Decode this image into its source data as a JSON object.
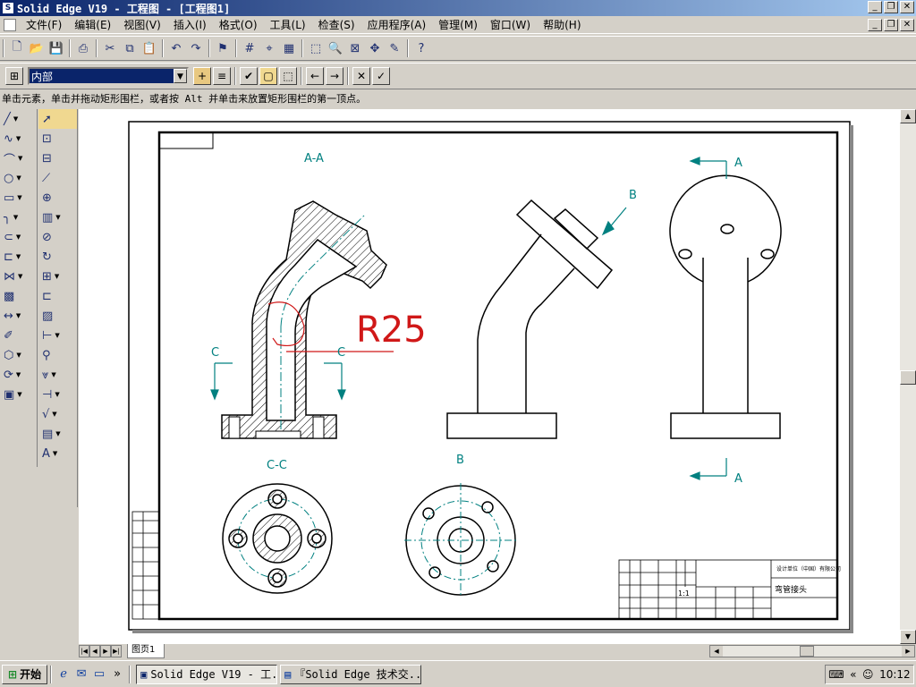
{
  "window": {
    "title": "Solid Edge V19 - 工程图 - [工程图1]"
  },
  "menu": [
    "文件(F)",
    "编辑(E)",
    "视图(V)",
    "插入(I)",
    "格式(O)",
    "工具(L)",
    "检查(S)",
    "应用程序(A)",
    "管理(M)",
    "窗口(W)",
    "帮助(H)"
  ],
  "toolbar2": {
    "layer_value": "内部"
  },
  "prompt": "单击元素，单击并拖动矩形围栏，或者按 Alt 并单击来放置矩形围栏的第一顶点。",
  "drawing": {
    "section_aa": "A-A",
    "section_cc": "C-C",
    "view_b": "B",
    "arrow_a_top": "A",
    "arrow_a_bottom": "A",
    "arrow_b": "B",
    "cut_c_left": "C",
    "cut_c_right": "C",
    "annotation": "R25",
    "title_block_company": "设计单位（中国）有限公司",
    "title_block_name": "弯管接头",
    "title_block_scale": "1:1"
  },
  "sheet_tab": "图页1",
  "taskbar": {
    "start": "开始",
    "tasks": [
      "Solid Edge V19 - 工...",
      "『Solid Edge 技术交..."
    ],
    "clock": "10:12"
  },
  "colors": {
    "title_start": "#0a246a",
    "title_end": "#a6caf0",
    "annotation": "#d01818",
    "dim": "#008080"
  }
}
